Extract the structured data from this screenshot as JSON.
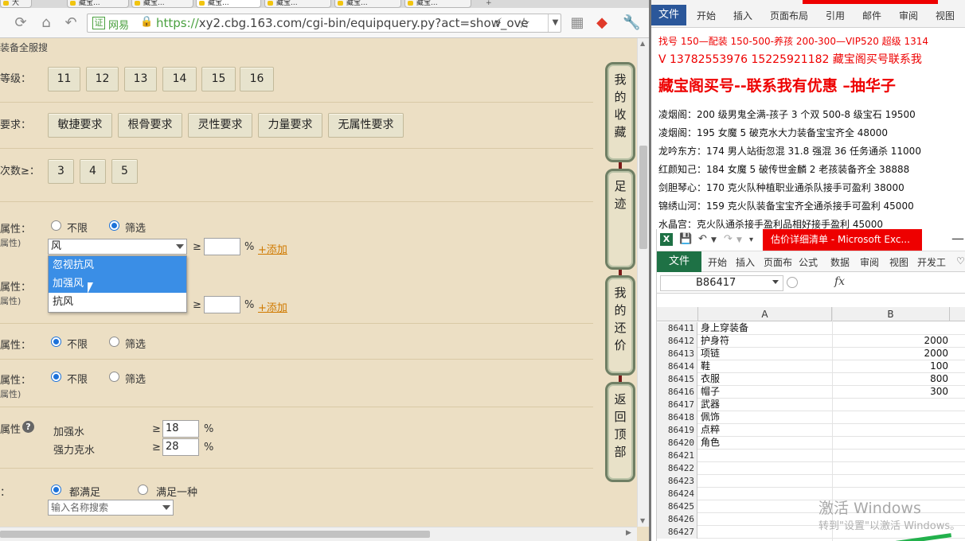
{
  "browser": {
    "tabs": [
      "大",
      "藏宝...",
      "藏宝...",
      "藏宝...",
      "藏宝...",
      "藏宝...",
      "藏宝...",
      "+"
    ],
    "site_label": "网易",
    "url_prefix": "https://",
    "url_rest": "xy2.cbg.163.com/cgi-bin/equipquery.py?act=show_ove"
  },
  "page": {
    "truncated_header": "装备全服搜",
    "level_label": "等级：",
    "level_options": [
      "11",
      "12",
      "13",
      "14",
      "15",
      "16"
    ],
    "req_label": "要求：",
    "req_options": [
      "敏捷要求",
      "根骨要求",
      "灵性要求",
      "力量要求",
      "无属性要求"
    ],
    "times_label": "次数≥：",
    "times_options": [
      "3",
      "4",
      "5"
    ],
    "attr1": {
      "label": "属性：",
      "sub": "属性)",
      "radio_unlimited": "不限",
      "radio_filter": "筛选",
      "combo_value": "风",
      "ge": "≥",
      "pct": "%",
      "add": "+添加"
    },
    "dropdown_options": [
      "忽视抗风",
      "加强风",
      "抗风"
    ],
    "attr2": {
      "label": "属性：",
      "sub": "属性)",
      "ge": "≥",
      "pct": "%",
      "add": "+添加"
    },
    "attr3": {
      "label": "属性：",
      "radio_unlimited": "不限",
      "radio_filter": "筛选"
    },
    "attr4": {
      "label": "属性：",
      "sub": "属性)",
      "radio_unlimited": "不限",
      "radio_filter": "筛选"
    },
    "attr5": {
      "label": "属性",
      "help": "?",
      "rows": [
        {
          "name": "加强水",
          "ge": "≥",
          "value": "18",
          "pct": "%"
        },
        {
          "name": "强力克水",
          "ge": "≥",
          "value": "28",
          "pct": "%"
        }
      ]
    },
    "match": {
      "label": "：",
      "all": "都满足",
      "any": "满足一种",
      "search_placeholder": "输入名称搜索"
    },
    "side_buttons": [
      "我的收藏",
      "足迹",
      "我的还价",
      "返回顶部"
    ]
  },
  "word": {
    "file": "文件",
    "tabs": [
      "开始",
      "插入",
      "页面布局",
      "引用",
      "邮件",
      "审阅",
      "视图"
    ],
    "lines": [
      "找号 150—配装 150-500-养孩 200-300—VIP520 超级 1314",
      "V 13782553976    15225921182  藏宝阁买号联系我",
      "藏宝阁买号--联系我有优惠 –抽华子",
      "凌烟阁：200 级男鬼全满-孩子 3 个双 500-8 级宝石 19500",
      "凌烟阁：195 女魔 5 破克水大力装备宝宝齐全 48000",
      "龙吟东方：174 男人站街忽混 31.8 强混 36 任务通杀 11000",
      "红颜知己：184 女魔 5 破传世金麟 2 老孩装备齐全 38888",
      "剑胆琴心：170 克火队种植职业通杀队接手可盈利 38000",
      "锦绣山河：159 克火队装备宝宝齐全通杀接手可盈利 45000",
      "水晶宫：克火队通杀接手盈利品相好接手盈利 45000"
    ]
  },
  "excel": {
    "title": "估价详细清单 - Microsoft Exc...",
    "file": "文件",
    "tabs": [
      "开始",
      "插入",
      "页面布",
      "公式",
      "数据",
      "审阅",
      "视图",
      "开发工"
    ],
    "namebox": "B86417",
    "fx": "fx",
    "col_a": "A",
    "col_b": "B",
    "rows": [
      {
        "n": "86411",
        "a": "身上穿装备",
        "b": ""
      },
      {
        "n": "86412",
        "a": "护身符",
        "b": "2000"
      },
      {
        "n": "86413",
        "a": "项链",
        "b": "2000"
      },
      {
        "n": "86414",
        "a": "鞋",
        "b": "100"
      },
      {
        "n": "86415",
        "a": "衣服",
        "b": "800"
      },
      {
        "n": "86416",
        "a": "帽子",
        "b": "300"
      },
      {
        "n": "86417",
        "a": "武器",
        "b": ""
      },
      {
        "n": "86418",
        "a": "佩饰",
        "b": ""
      },
      {
        "n": "86419",
        "a": "点粹",
        "b": ""
      },
      {
        "n": "86420",
        "a": "角色",
        "b": ""
      },
      {
        "n": "86421",
        "a": "",
        "b": ""
      },
      {
        "n": "86422",
        "a": "",
        "b": ""
      },
      {
        "n": "86423",
        "a": "",
        "b": ""
      },
      {
        "n": "86424",
        "a": "",
        "b": ""
      },
      {
        "n": "86425",
        "a": "",
        "b": ""
      },
      {
        "n": "86426",
        "a": "",
        "b": ""
      },
      {
        "n": "86427",
        "a": "",
        "b": ""
      }
    ],
    "watermark_title": "激活 Windows",
    "watermark_sub": "转到\"设置\"以激活 Windows。"
  },
  "colors": {
    "page_bg": "#ecdfc4",
    "excel_green": "#1e7145",
    "word_blue": "#2b579a",
    "accent_red": "#e00000",
    "link_orange": "#d07a00"
  }
}
